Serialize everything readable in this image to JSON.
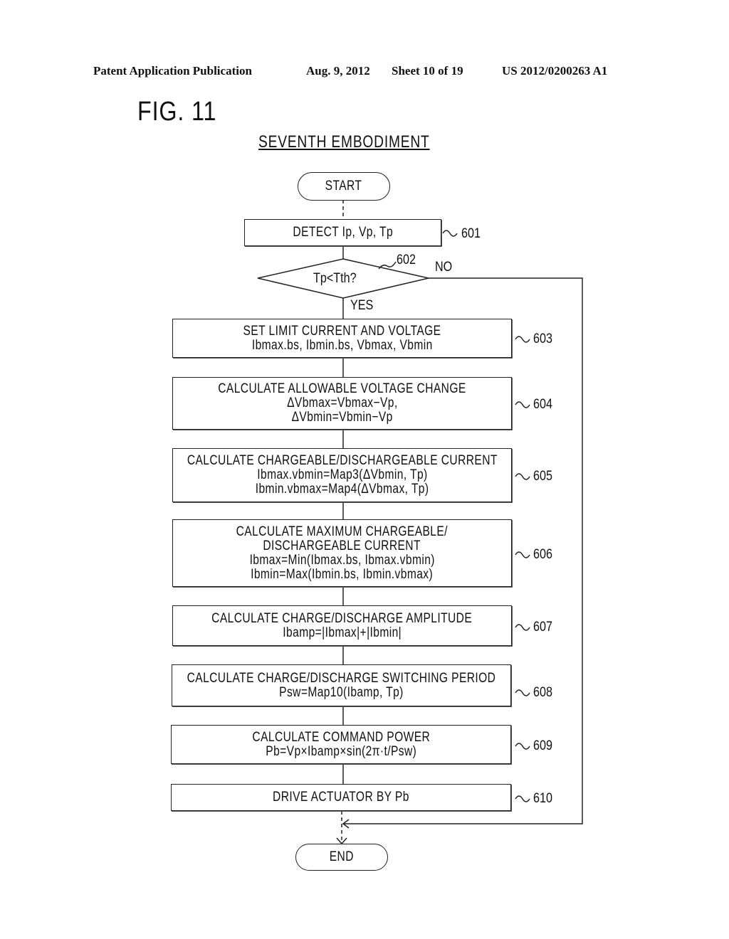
{
  "header": {
    "publication": "Patent Application Publication",
    "date": "Aug. 9, 2012",
    "sheet": "Sheet 10 of 19",
    "patent_number": "US 2012/0200263 A1"
  },
  "figure": {
    "title": "FIG. 11",
    "subtitle": "SEVENTH EMBODIMENT"
  },
  "flowchart": {
    "start": "START",
    "end": "END",
    "steps": [
      {
        "ref": "601",
        "lines": [
          "DETECT Ip, Vp, Tp"
        ]
      },
      {
        "ref": "602",
        "lines": [
          "Tp<Tth?"
        ],
        "yes": "YES",
        "no": "NO"
      },
      {
        "ref": "603",
        "lines": [
          "SET LIMIT CURRENT AND VOLTAGE",
          "Ibmax.bs, Ibmin.bs, Vbmax, Vbmin"
        ]
      },
      {
        "ref": "604",
        "lines": [
          "CALCULATE ALLOWABLE VOLTAGE CHANGE",
          "ΔVbmax=Vbmax−Vp,",
          "ΔVbmin=Vbmin−Vp"
        ]
      },
      {
        "ref": "605",
        "lines": [
          "CALCULATE CHARGEABLE/DISCHARGEABLE CURRENT",
          "Ibmax.vbmin=Map3(ΔVbmin, Tp)",
          "Ibmin.vbmax=Map4(ΔVbmax, Tp)"
        ]
      },
      {
        "ref": "606",
        "lines": [
          "CALCULATE MAXIMUM CHARGEABLE/",
          "DISCHARGEABLE CURRENT",
          "Ibmax=Min(Ibmax.bs, Ibmax.vbmin)",
          "Ibmin=Max(Ibmin.bs, Ibmin.vbmax)"
        ]
      },
      {
        "ref": "607",
        "lines": [
          "CALCULATE CHARGE/DISCHARGE AMPLITUDE",
          "Ibamp=|Ibmax|+|Ibmin|"
        ]
      },
      {
        "ref": "608",
        "lines": [
          "CALCULATE CHARGE/DISCHARGE SWITCHING PERIOD",
          "Psw=Map10(Ibamp, Tp)"
        ]
      },
      {
        "ref": "609",
        "lines": [
          "CALCULATE COMMAND POWER",
          "Pb=Vp×Ibamp×sin(2π·t/Psw)"
        ]
      },
      {
        "ref": "610",
        "lines": [
          "DRIVE ACTUATOR BY Pb"
        ]
      }
    ]
  }
}
